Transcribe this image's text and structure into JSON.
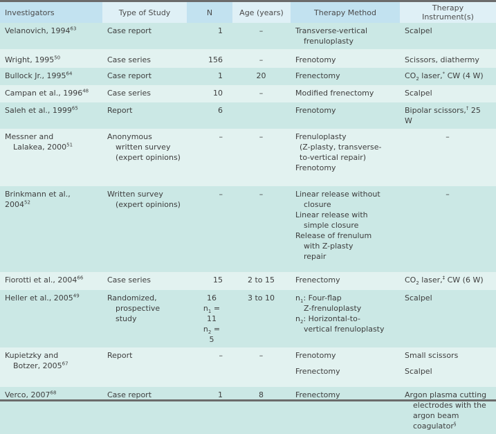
{
  "table": {
    "headers": [
      "Investigators",
      "Type of Study",
      "N",
      "Age (years)",
      "Therapy Method",
      "Therapy Instrument(s)"
    ],
    "rows": [
      {
        "investigator": [
          "Velanovich, 1994"
        ],
        "ref": "63",
        "type": [
          "Case report"
        ],
        "n": [
          "1"
        ],
        "age": "–",
        "method": [
          "Transverse-vertical",
          "frenuloplasty"
        ],
        "instrument": [
          "Scalpel"
        ]
      },
      {
        "investigator": [
          "Wright, 1995"
        ],
        "ref": "50",
        "type": [
          "Case series"
        ],
        "n": [
          "156"
        ],
        "age": "–",
        "method": [
          "Frenotomy"
        ],
        "instrument": [
          "Scissors, diathermy"
        ]
      },
      {
        "investigator": [
          "Bullock Jr., 1995"
        ],
        "ref": "64",
        "type": [
          "Case report"
        ],
        "n": [
          "1"
        ],
        "age": "20",
        "method": [
          "Frenectomy"
        ],
        "instrument_parts": {
          "pre": "CO",
          "sub": "2",
          "mid": " laser,",
          "sup": "*",
          "post": " CW (4 W)"
        }
      },
      {
        "investigator": [
          "Campan et al., 1996"
        ],
        "ref": "48",
        "type": [
          "Case series"
        ],
        "n": [
          "10"
        ],
        "age": "–",
        "method": [
          "Modified frenectomy"
        ],
        "instrument": [
          "Scalpel"
        ]
      },
      {
        "investigator": [
          "Saleh et al., 1999"
        ],
        "ref": "65",
        "type": [
          "Report"
        ],
        "n": [
          "6"
        ],
        "age": "",
        "method": [
          "Frenotomy"
        ],
        "instrument_parts": {
          "pre": "Bipolar scissors,",
          "sup": "†",
          "post": " 25 W"
        }
      },
      {
        "investigator": [
          "Messner and",
          "Lalakea, 2000"
        ],
        "ref": "51",
        "type": [
          "Anonymous",
          "written survey",
          "(expert opinions)"
        ],
        "n": [
          "–"
        ],
        "age": "–",
        "method": [
          "Frenuloplasty",
          "(Z-plasty, transverse-",
          "to-vertical repair)",
          "Frenotomy"
        ],
        "instrument": [
          "–"
        ]
      },
      {
        "investigator": [
          "Brinkmann et al., 2004"
        ],
        "ref": "52",
        "type": [
          "Written survey",
          "(expert opinions)"
        ],
        "n": [
          "–"
        ],
        "age": "–",
        "method": [
          "Linear release without",
          "closure",
          "Linear release with",
          "simple closure",
          "Release of frenulum",
          "with Z-plasty",
          "repair"
        ],
        "instrument": [
          "–"
        ]
      },
      {
        "investigator": [
          "Fiorotti et al., 2004"
        ],
        "ref": "66",
        "type": [
          "Case series"
        ],
        "n": [
          "15"
        ],
        "age": "2 to 15",
        "method": [
          "Frenectomy"
        ],
        "instrument_parts": {
          "pre": "CO",
          "sub": "2",
          "mid": " laser,",
          "sup": "‡",
          "post": " CW (6 W)"
        }
      },
      {
        "investigator": [
          "Heller et al., 2005"
        ],
        "ref": "49",
        "type": [
          "Randomized,",
          "prospective",
          "study"
        ],
        "n": [
          "16",
          "n1 = 11",
          "n2 = 5"
        ],
        "age": "3 to 10",
        "method": [
          "n1: Four-flap",
          "Z-frenuloplasty",
          "n2: Horizontal-to-",
          "vertical frenuloplasty"
        ],
        "instrument": [
          "Scalpel"
        ]
      },
      {
        "investigator": [
          "Kupietzky and",
          "Botzer, 2005"
        ],
        "ref": "67",
        "type": [
          "Report"
        ],
        "n": [
          "–"
        ],
        "age": "–",
        "method": [
          "Frenotomy",
          "Frenectomy"
        ],
        "instrument": [
          "Small scissors",
          "Scalpel"
        ]
      },
      {
        "investigator": [
          "Verco, 2007"
        ],
        "ref": "68",
        "type": [
          "Case report"
        ],
        "n": [
          "1"
        ],
        "age": "8",
        "method": [
          "Frenectomy"
        ],
        "instrument": [
          "Argon plasma cutting",
          "electrodes with the",
          "argon beam coagulator"
        ],
        "instrument_sup": "§"
      }
    ]
  }
}
